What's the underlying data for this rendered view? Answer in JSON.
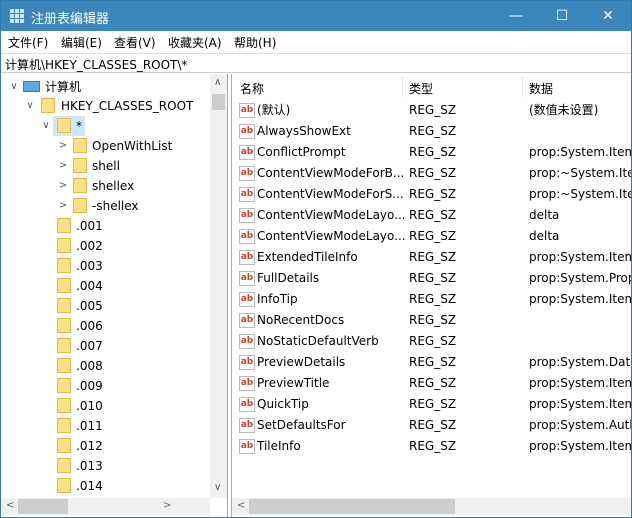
{
  "window": {
    "title": "注册表编辑器",
    "minimize": "—",
    "maximize": "☐",
    "close": "✕"
  },
  "menu": [
    "文件(F)",
    "编辑(E)",
    "查看(V)",
    "收藏夹(A)",
    "帮助(H)"
  ],
  "address": "计算机\\HKEY_CLASSES_ROOT\\*",
  "tree": {
    "root": "计算机",
    "hive": "HKEY_CLASSES_ROOT",
    "selected": "*",
    "children": [
      "OpenWithList",
      "shell",
      "shellex",
      "-shellex"
    ],
    "siblings": [
      ".001",
      ".002",
      ".003",
      ".004",
      ".005",
      ".006",
      ".007",
      ".008",
      ".009",
      ".010",
      ".011",
      ".012",
      ".013",
      ".014"
    ]
  },
  "list": {
    "columns": [
      "名称",
      "类型",
      "数据"
    ],
    "rows": [
      {
        "name": "(默认)",
        "type": "REG_SZ",
        "data": "(数值未设置)"
      },
      {
        "name": "AlwaysShowExt",
        "type": "REG_SZ",
        "data": ""
      },
      {
        "name": "ConflictPrompt",
        "type": "REG_SZ",
        "data": "prop:System.Item"
      },
      {
        "name": "ContentViewModeForB...",
        "type": "REG_SZ",
        "data": "prop:~System.Iten"
      },
      {
        "name": "ContentViewModeForS...",
        "type": "REG_SZ",
        "data": "prop:~System.Iten"
      },
      {
        "name": "ContentViewModeLayo...",
        "type": "REG_SZ",
        "data": "delta"
      },
      {
        "name": "ContentViewModeLayo...",
        "type": "REG_SZ",
        "data": "delta"
      },
      {
        "name": "ExtendedTileInfo",
        "type": "REG_SZ",
        "data": "prop:System.Item"
      },
      {
        "name": "FullDetails",
        "type": "REG_SZ",
        "data": "prop:System.Prop"
      },
      {
        "name": "InfoTip",
        "type": "REG_SZ",
        "data": "prop:System.Item"
      },
      {
        "name": "NoRecentDocs",
        "type": "REG_SZ",
        "data": ""
      },
      {
        "name": "NoStaticDefaultVerb",
        "type": "REG_SZ",
        "data": ""
      },
      {
        "name": "PreviewDetails",
        "type": "REG_SZ",
        "data": "prop:System.Date"
      },
      {
        "name": "PreviewTitle",
        "type": "REG_SZ",
        "data": "prop:System.Item"
      },
      {
        "name": "QuickTip",
        "type": "REG_SZ",
        "data": "prop:System.Item"
      },
      {
        "name": "SetDefaultsFor",
        "type": "REG_SZ",
        "data": "prop:System.Auth"
      },
      {
        "name": "TileInfo",
        "type": "REG_SZ",
        "data": "prop:System.Item"
      }
    ]
  },
  "icon_text": "ab"
}
